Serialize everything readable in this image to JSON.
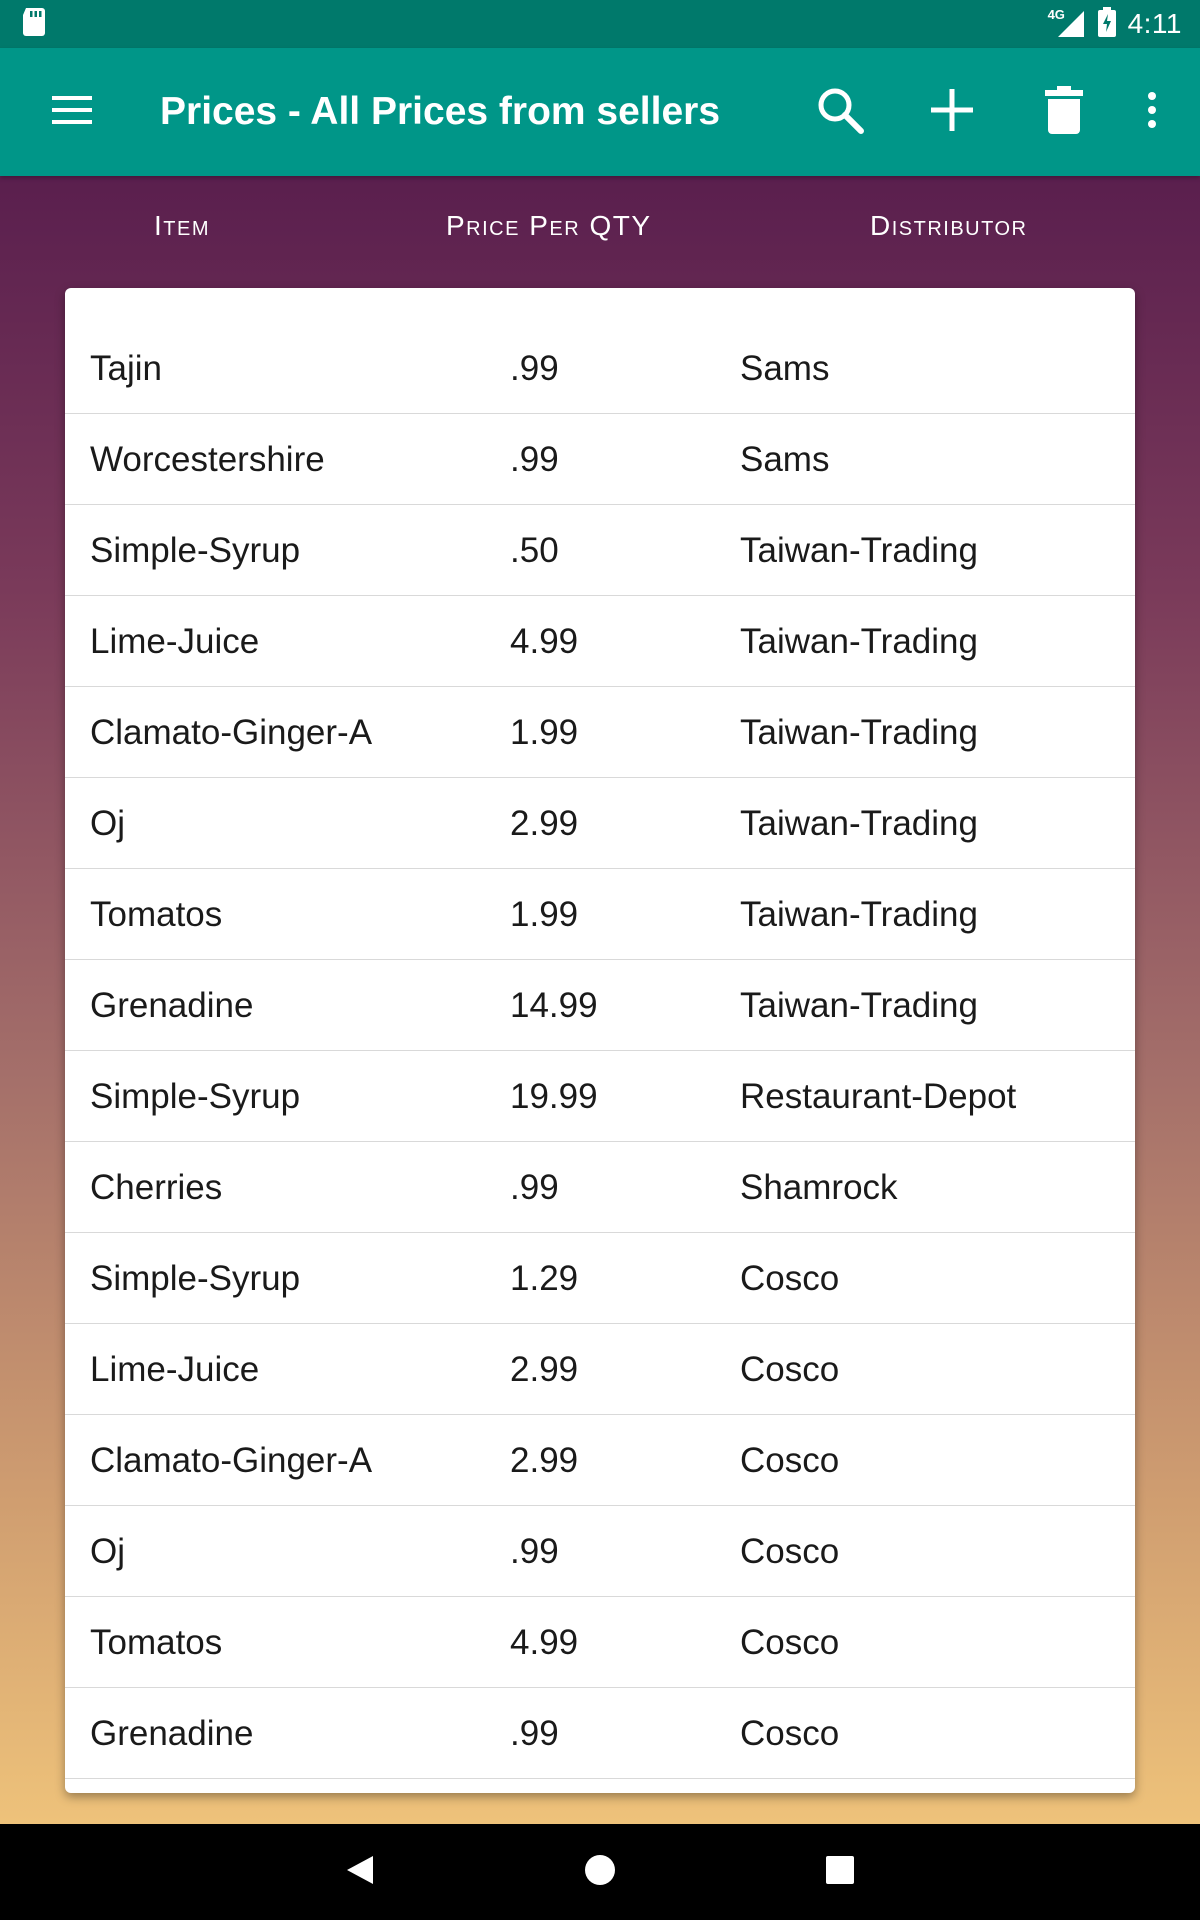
{
  "status_bar": {
    "network": "4G",
    "time": "4:11"
  },
  "app_bar": {
    "title": "Prices - All Prices from sellers",
    "icons": [
      "menu-icon",
      "search-icon",
      "add-icon",
      "delete-icon",
      "more-vert-icon"
    ]
  },
  "table": {
    "headers": {
      "item": "Item",
      "price": "Price Per QTY",
      "distributor": "Distributor"
    },
    "rows": [
      {
        "item": "Tajin",
        "price": ".99",
        "distributor": "Sams"
      },
      {
        "item": "Worcestershire",
        "price": ".99",
        "distributor": "Sams"
      },
      {
        "item": "Simple-Syrup",
        "price": ".50",
        "distributor": "Taiwan-Trading"
      },
      {
        "item": "Lime-Juice",
        "price": "4.99",
        "distributor": "Taiwan-Trading"
      },
      {
        "item": "Clamato-Ginger-A",
        "price": "1.99",
        "distributor": "Taiwan-Trading"
      },
      {
        "item": "Oj",
        "price": "2.99",
        "distributor": "Taiwan-Trading"
      },
      {
        "item": "Tomatos",
        "price": "1.99",
        "distributor": "Taiwan-Trading"
      },
      {
        "item": "Grenadine",
        "price": "14.99",
        "distributor": "Taiwan-Trading"
      },
      {
        "item": "Simple-Syrup",
        "price": "19.99",
        "distributor": "Restaurant-Depot"
      },
      {
        "item": "Cherries",
        "price": ".99",
        "distributor": "Shamrock"
      },
      {
        "item": "Simple-Syrup",
        "price": "1.29",
        "distributor": "Cosco"
      },
      {
        "item": "Lime-Juice",
        "price": "2.99",
        "distributor": "Cosco"
      },
      {
        "item": "Clamato-Ginger-A",
        "price": "2.99",
        "distributor": "Cosco"
      },
      {
        "item": "Oj",
        "price": ".99",
        "distributor": "Cosco"
      },
      {
        "item": "Tomatos",
        "price": "4.99",
        "distributor": "Cosco"
      },
      {
        "item": "Grenadine",
        "price": ".99",
        "distributor": "Cosco"
      }
    ]
  },
  "colors": {
    "status_bar": "#00796b",
    "app_bar": "#009688",
    "gradient_top": "#5a1f4e",
    "gradient_bottom": "#eec27a",
    "card": "#ffffff"
  }
}
